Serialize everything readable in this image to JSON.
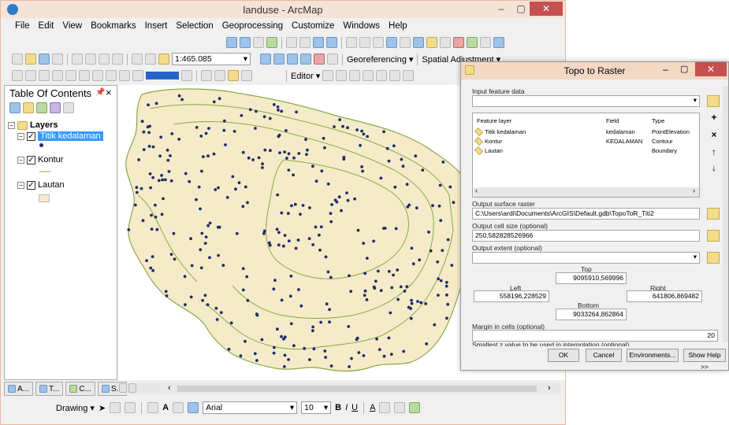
{
  "app": {
    "title": "landuse - ArcMap",
    "min": "–",
    "max": "▢",
    "close": "✕"
  },
  "menu": [
    "File",
    "Edit",
    "View",
    "Bookmarks",
    "Insert",
    "Selection",
    "Geoprocessing",
    "Customize",
    "Windows",
    "Help"
  ],
  "toolbar": {
    "scale": "1:465.085",
    "georef": "Georeferencing ▾",
    "spatial_adj": "Spatial Adjustment ▾",
    "editor": "Editor ▾"
  },
  "toc": {
    "title": "Table Of Contents",
    "root": "Layers",
    "layers": [
      {
        "name": "Titik kedalaman",
        "selected": true
      },
      {
        "name": "Kontur",
        "selected": false
      },
      {
        "name": "Lautan",
        "selected": false
      }
    ]
  },
  "bottom": {
    "tabs": [
      "A...",
      "T...",
      "C...",
      "S..."
    ],
    "drawing": "Drawing ▾",
    "font": "Arial",
    "size": "10",
    "bold": "B",
    "italic": "I",
    "underline": "U",
    "fontcolor": "A"
  },
  "dialog": {
    "title": "Topo to Raster",
    "input_label": "Input feature data",
    "grid_headers": [
      "Feature layer",
      "Field",
      "Type"
    ],
    "grid_rows": [
      {
        "layer": "Titik kedalaman",
        "field": "kedalaman",
        "type": "PointElevation"
      },
      {
        "layer": "Kontur",
        "field": "KEDALAMAN",
        "type": "Contour"
      },
      {
        "layer": "Lautan",
        "field": "",
        "type": "Boundary"
      }
    ],
    "output_raster_label": "Output surface raster",
    "output_raster": "C:\\Users\\ardi\\Documents\\ArcGIS\\Default.gdb\\TopoToR_Titi2",
    "cell_size_label": "Output cell size (optional)",
    "cell_size": "250,582828526966",
    "extent_label": "Output extent (optional)",
    "top_label": "Top",
    "top": "9095910,569996",
    "left_label": "Left",
    "left": "558196,228529",
    "right_label": "Right",
    "right": "641806,869482",
    "bottom_label": "Bottom",
    "bottom": "9033264,862864",
    "margin_label": "Margin in cells (optional)",
    "margin": "20",
    "cut_label": "Smallest z value to be used in interpolation (optional)",
    "buttons": {
      "ok": "OK",
      "cancel": "Cancel",
      "env": "Environments...",
      "help": "Show Help >>"
    }
  },
  "colors": {
    "land": "#f5ebc8",
    "contour": "#8aa84a",
    "point": "#1d2e6b",
    "selection": "#3399ff"
  }
}
